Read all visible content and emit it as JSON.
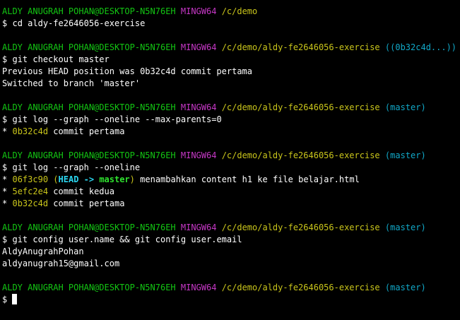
{
  "prompt": {
    "user_host": "ALDY ANUGRAH POHAN@DESKTOP-N5N76EH",
    "shell": "MINGW64",
    "symbol": "$"
  },
  "blocks": [
    {
      "path": "/c/demo",
      "branch": "",
      "command": "cd aldy-fe2646056-exercise",
      "output": []
    },
    {
      "path": "/c/demo/aldy-fe2646056-exercise",
      "branch": "((0b32c4d...))",
      "command": "git checkout master",
      "output": [
        "Previous HEAD position was 0b32c4d commit pertama",
        "Switched to branch 'master'"
      ]
    },
    {
      "path": "/c/demo/aldy-fe2646056-exercise",
      "branch": "(master)",
      "command": "git log --graph --oneline --max-parents=0",
      "log": [
        {
          "star": "*",
          "hash": "0b32c4d",
          "msg": "commit pertama"
        }
      ]
    },
    {
      "path": "/c/demo/aldy-fe2646056-exercise",
      "branch": "(master)",
      "command": "git log --graph --oneline",
      "log": [
        {
          "star": "*",
          "hash": "06f3c90",
          "ref_open": "(",
          "ref_head": "HEAD -> master",
          "ref_close": ")",
          "msg": "menambahkan content h1 ke file belajar.html"
        },
        {
          "star": "*",
          "hash": "5efc2e4",
          "msg": "commit kedua"
        },
        {
          "star": "*",
          "hash": "0b32c4d",
          "msg": "commit pertama"
        }
      ]
    },
    {
      "path": "/c/demo/aldy-fe2646056-exercise",
      "branch": "(master)",
      "command": "git config user.name && git config user.email",
      "output": [
        "AldyAnugrahPohan",
        "aldyanugrah15@gmail.com"
      ]
    },
    {
      "path": "/c/demo/aldy-fe2646056-exercise",
      "branch": "(master)",
      "command": "",
      "output": []
    }
  ]
}
